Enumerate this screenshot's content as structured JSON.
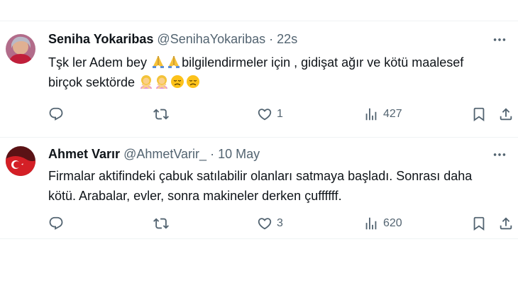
{
  "tweets": [
    {
      "name": "Seniha Yokaribas",
      "handle": "@SenihaYokaribas",
      "separator": "·",
      "time": "22s",
      "body_part1": "Tşk ler Adem bey",
      "body_part2": "bilgilendirmeler için , gidişat ağır ve kötü maalesef",
      "body_part3": "birçok sektörde",
      "emojis": [
        "folded-hands",
        "folded-hands",
        "woman-gesturing-no",
        "woman-gesturing-no",
        "disappointed-face",
        "disappointed-face"
      ],
      "replies": "",
      "retweets": "",
      "likes": "1",
      "views": "427"
    },
    {
      "name": "Ahmet Varır",
      "handle": "@AhmetVarir_",
      "separator": "·",
      "time": "10 May",
      "body_line1": "Firmalar aktifindeki çabuk satılabilir olanları satmaya başladı. Sonrası daha",
      "body_line2": "kötü. Arabalar, evler, sonra makineler derken çuffffff.",
      "replies": "",
      "retweets": "",
      "likes": "3",
      "views": "620"
    }
  ],
  "colors": {
    "text": "#0f1419",
    "secondary": "#536471",
    "divider": "#eff3f4"
  }
}
